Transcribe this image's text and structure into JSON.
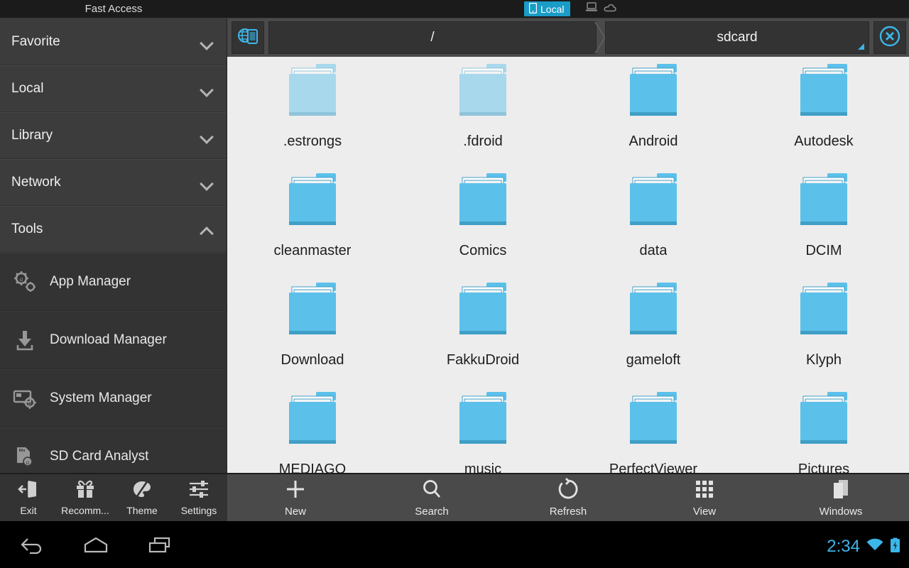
{
  "statusbar": {
    "fast_access_title": "Fast Access",
    "local_badge": {
      "label": "Local",
      "icon": "phone-icon",
      "active_color": "#1a9cc7"
    },
    "mini_icons": [
      "computer-icon",
      "cloud-icon"
    ]
  },
  "breadcrumb": {
    "home_icon": "globe-device-icon",
    "segments": [
      {
        "label": "/",
        "name": "crumb-root"
      },
      {
        "label": "sdcard",
        "name": "crumb-current",
        "marker": true
      }
    ],
    "close_icon": "close-circle-icon"
  },
  "sidebar": {
    "groups": [
      {
        "label": "Favorite",
        "expanded": false,
        "icon": "chevron-down-icon"
      },
      {
        "label": "Local",
        "expanded": false,
        "icon": "chevron-down-icon"
      },
      {
        "label": "Library",
        "expanded": false,
        "icon": "chevron-down-icon"
      },
      {
        "label": "Network",
        "expanded": false,
        "icon": "chevron-down-icon"
      },
      {
        "label": "Tools",
        "expanded": true,
        "icon": "chevron-up-icon"
      }
    ],
    "tools": [
      {
        "label": "App Manager",
        "icon": "gears-app-icon"
      },
      {
        "label": "Download Manager",
        "icon": "download-arrow-icon"
      },
      {
        "label": "System Manager",
        "icon": "system-card-gear-icon"
      },
      {
        "label": "SD Card Analyst",
        "icon": "sd-card-icon"
      }
    ]
  },
  "left_toolbar": {
    "buttons": [
      {
        "label": "Exit",
        "icon": "exit-door-icon"
      },
      {
        "label": "Recomm...",
        "icon": "gift-icon"
      },
      {
        "label": "Theme",
        "icon": "palette-icon"
      },
      {
        "label": "Settings",
        "icon": "sliders-icon"
      }
    ]
  },
  "main_toolbar": {
    "buttons": [
      {
        "label": "New",
        "icon": "plus-icon"
      },
      {
        "label": "Search",
        "icon": "search-icon"
      },
      {
        "label": "Refresh",
        "icon": "refresh-icon"
      },
      {
        "label": "View",
        "icon": "grid-icon"
      },
      {
        "label": "Windows",
        "icon": "windows-stack-icon"
      }
    ]
  },
  "files": {
    "colors": {
      "folder": "#5bc0ea",
      "folder_hidden": "#a8d8ec",
      "background": "#ededed"
    },
    "items": [
      {
        "name": ".estrongs",
        "type": "folder",
        "hidden": true
      },
      {
        "name": ".fdroid",
        "type": "folder",
        "hidden": true
      },
      {
        "name": "Android",
        "type": "folder",
        "hidden": false
      },
      {
        "name": "Autodesk",
        "type": "folder",
        "hidden": false
      },
      {
        "name": "cleanmaster",
        "type": "folder",
        "hidden": false
      },
      {
        "name": "Comics",
        "type": "folder",
        "hidden": false
      },
      {
        "name": "data",
        "type": "folder",
        "hidden": false
      },
      {
        "name": "DCIM",
        "type": "folder",
        "hidden": false
      },
      {
        "name": "Download",
        "type": "folder",
        "hidden": false
      },
      {
        "name": "FakkuDroid",
        "type": "folder",
        "hidden": false
      },
      {
        "name": "gameloft",
        "type": "folder",
        "hidden": false
      },
      {
        "name": "Klyph",
        "type": "folder",
        "hidden": false
      },
      {
        "name": "MEDIAGO",
        "type": "folder",
        "hidden": false
      },
      {
        "name": "music",
        "type": "folder",
        "hidden": false
      },
      {
        "name": "PerfectViewer",
        "type": "folder",
        "hidden": false
      },
      {
        "name": "Pictures",
        "type": "folder",
        "hidden": false
      }
    ]
  },
  "navbar": {
    "buttons": [
      {
        "icon": "back-icon"
      },
      {
        "icon": "home-icon"
      },
      {
        "icon": "recents-icon"
      }
    ],
    "clock": "2:34",
    "status_icons": [
      "wifi-icon",
      "battery-charging-icon"
    ],
    "accent_color": "#3cb6e8"
  }
}
